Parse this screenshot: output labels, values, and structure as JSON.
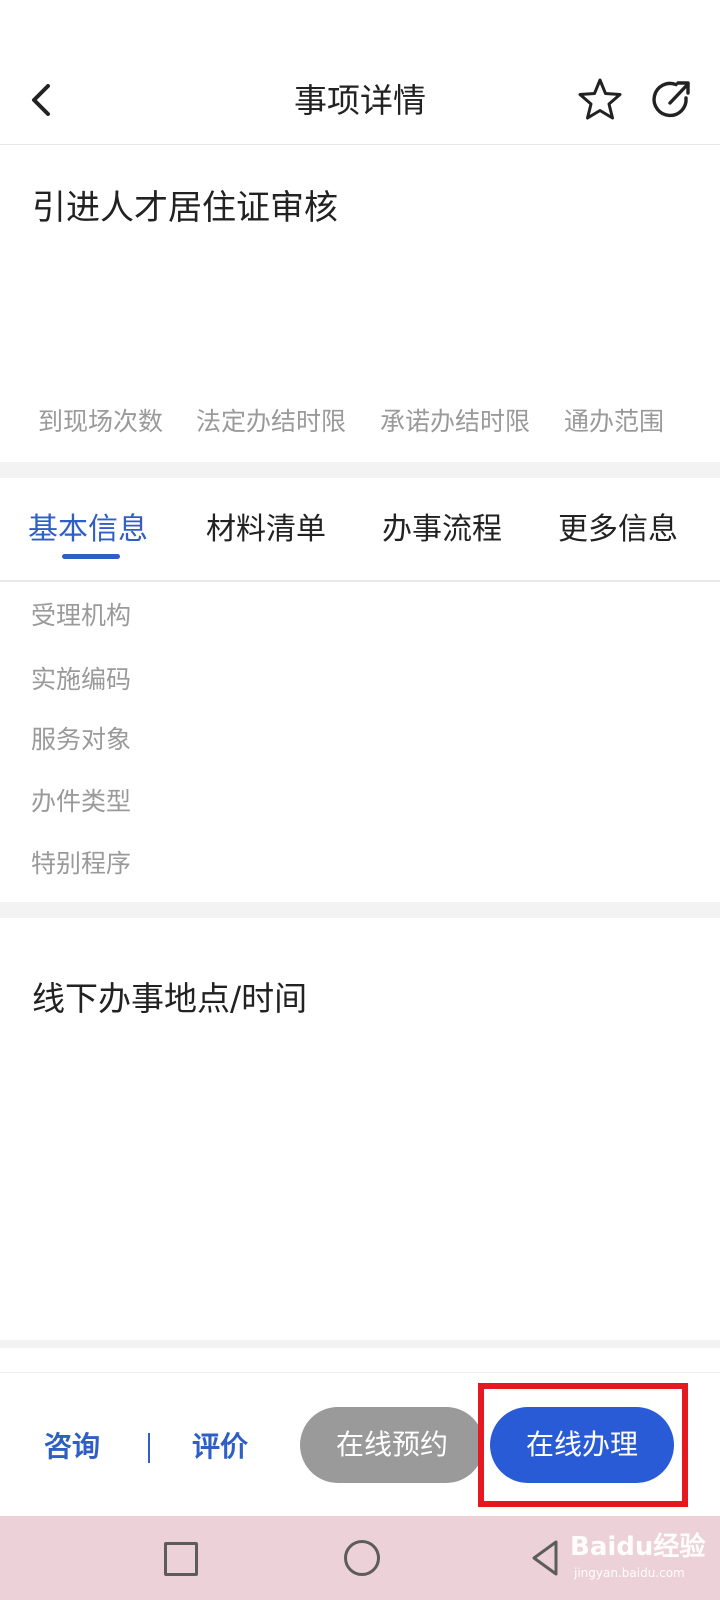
{
  "header": {
    "title": "事项详情",
    "back_icon": "chevron-left-icon",
    "favorite_icon": "star-icon",
    "share_icon": "share-icon"
  },
  "item": {
    "title": "引进人才居住证审核",
    "stats": [
      "到现场次数",
      "法定办结时限",
      "承诺办结时限",
      "通办范围"
    ]
  },
  "tabs": [
    {
      "label": "基本信息",
      "active": true
    },
    {
      "label": "材料清单",
      "active": false
    },
    {
      "label": "办事流程",
      "active": false
    },
    {
      "label": "更多信息",
      "active": false
    }
  ],
  "basic_info": {
    "labels": [
      "受理机构",
      "实施编码",
      "服务对象",
      "办件类型",
      "特别程序"
    ]
  },
  "offline": {
    "title": "线下办事地点/时间"
  },
  "actions": {
    "consult": "咨询",
    "evaluate": "评价",
    "reserve": "在线预约",
    "apply": "在线办理"
  },
  "watermark": {
    "brand": "Baidu经验",
    "url": "jingyan.baidu.com"
  },
  "colors": {
    "accent": "#2f5fc4",
    "primary_button": "#2a5bd7",
    "secondary_button": "#9a9a9a",
    "highlight_box": "#e5191f",
    "nav_bar": "#ecd2d8"
  }
}
